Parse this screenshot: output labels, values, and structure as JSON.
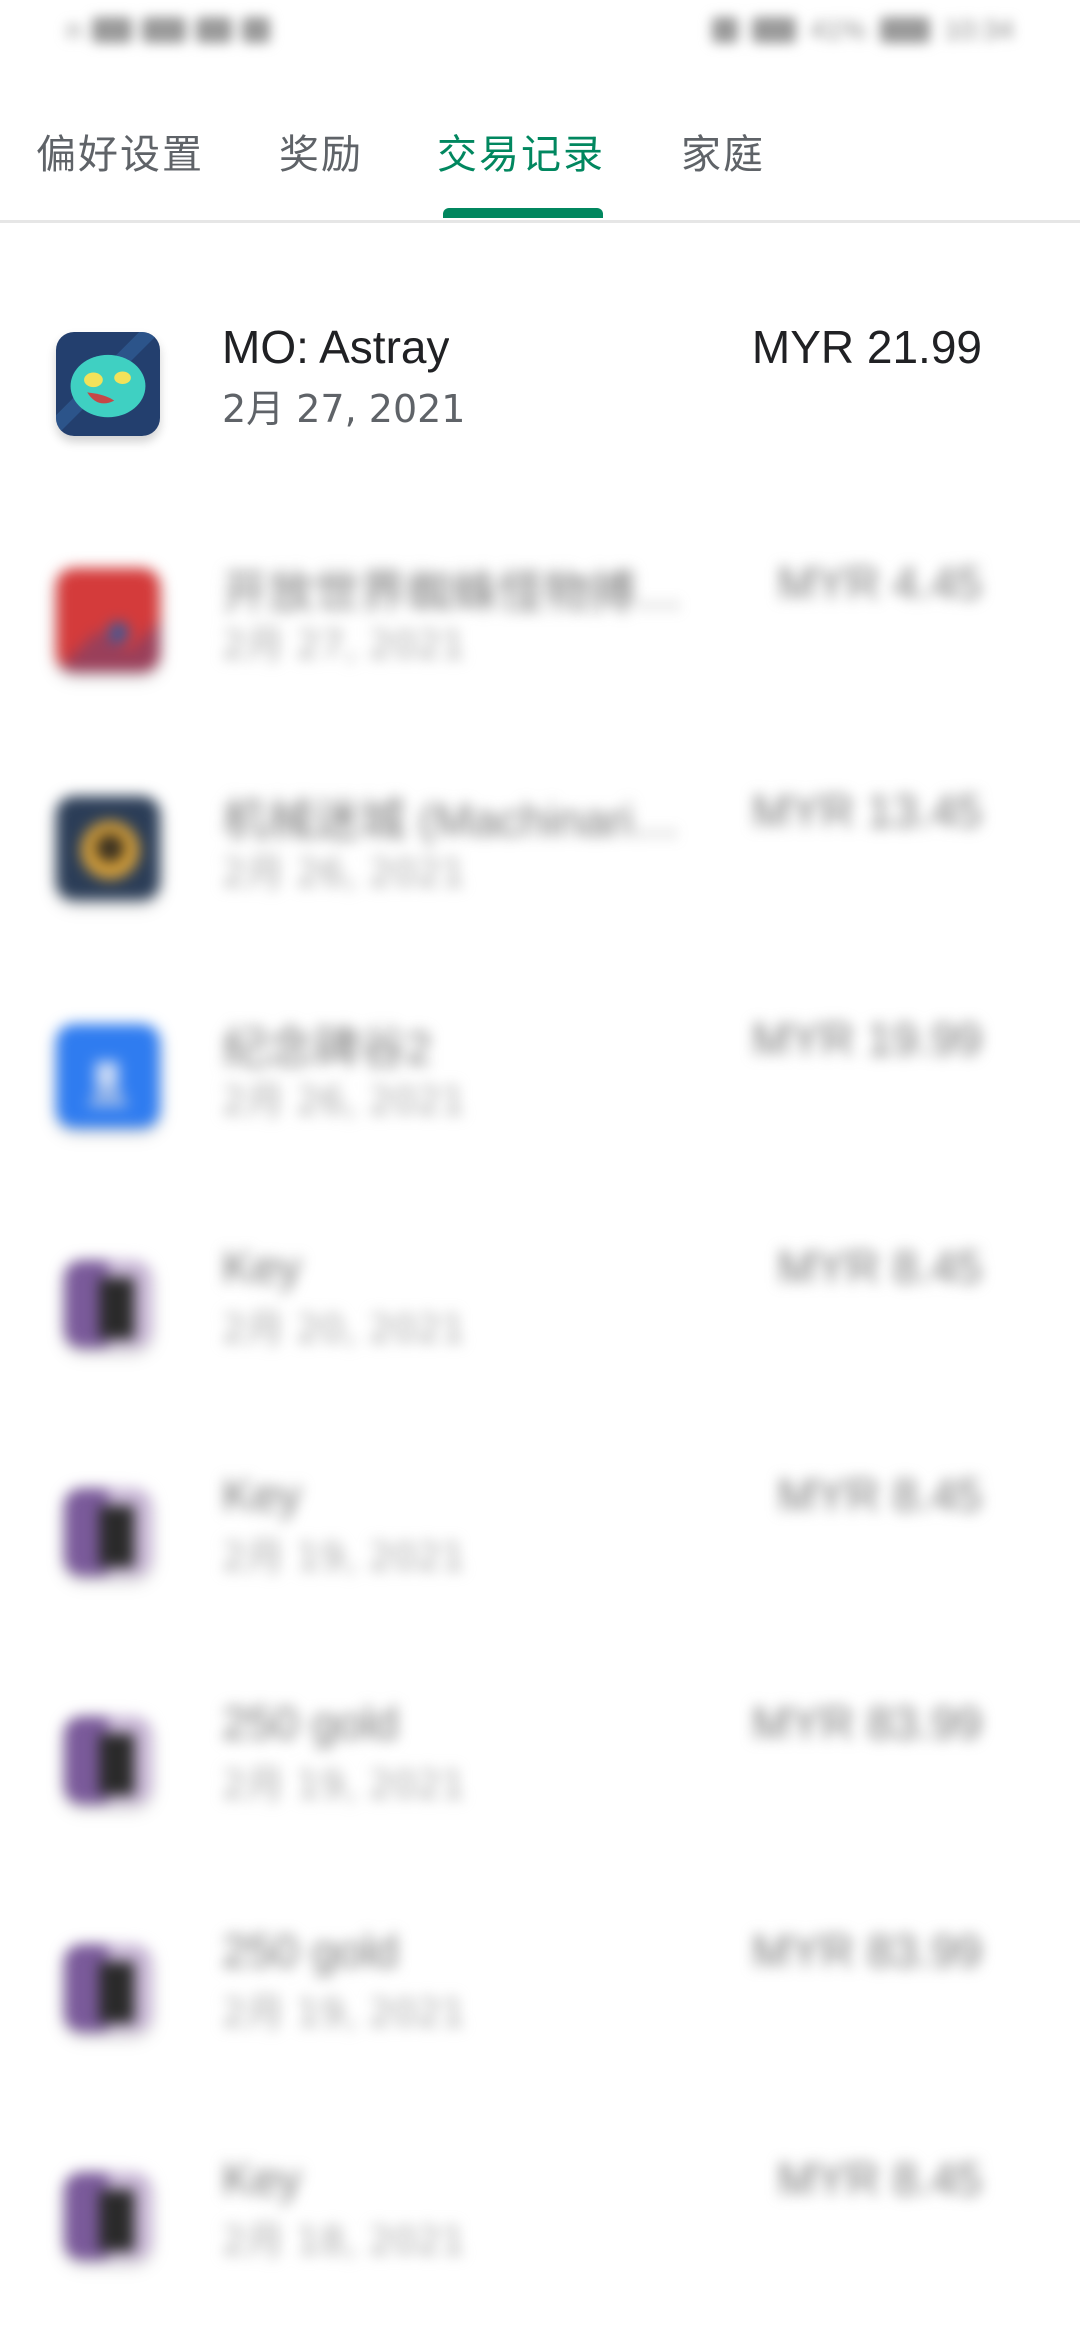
{
  "status_bar": {
    "left_text": "n",
    "battery_percent": "41%",
    "time": "10:34"
  },
  "tabs": [
    {
      "label": "偏好设置",
      "active": false
    },
    {
      "label": "奖励",
      "active": false
    },
    {
      "label": "交易记录",
      "active": true
    },
    {
      "label": "家庭",
      "active": false
    }
  ],
  "accent_color": "#01875f",
  "transactions": [
    {
      "name": "MO: Astray",
      "date": "2月 27, 2021",
      "price": "MYR 21.99",
      "icon": "mo-astray-app-icon"
    },
    {
      "name": "开放世界蜘蛛怪物搏…",
      "date": "2月 27, 2021",
      "price": "MYR 4.45",
      "icon": "red-game-app-icon"
    },
    {
      "name": "机械迷城 (Machinari…",
      "date": "2月 26, 2021",
      "price": "MYR 13.45",
      "icon": "machinarium-app-icon"
    },
    {
      "name": "纪念碑谷2",
      "date": "2月 26, 2021",
      "price": "MYR 19.99",
      "icon": "monument-valley-app-icon"
    },
    {
      "name": "Key",
      "date": "2月 20, 2021",
      "price": "MYR 8.45",
      "icon": "purple-game-app-icon"
    },
    {
      "name": "Key",
      "date": "2月 19, 2021",
      "price": "MYR 8.45",
      "icon": "purple-game-app-icon"
    },
    {
      "name": "250 gold",
      "date": "2月 19, 2021",
      "price": "MYR 83.99",
      "icon": "purple-game-app-icon"
    },
    {
      "name": "250 gold",
      "date": "2月 19, 2021",
      "price": "MYR 83.99",
      "icon": "purple-game-app-icon"
    },
    {
      "name": "Key",
      "date": "2月 18, 2021",
      "price": "MYR 8.45",
      "icon": "purple-game-app-icon"
    }
  ]
}
